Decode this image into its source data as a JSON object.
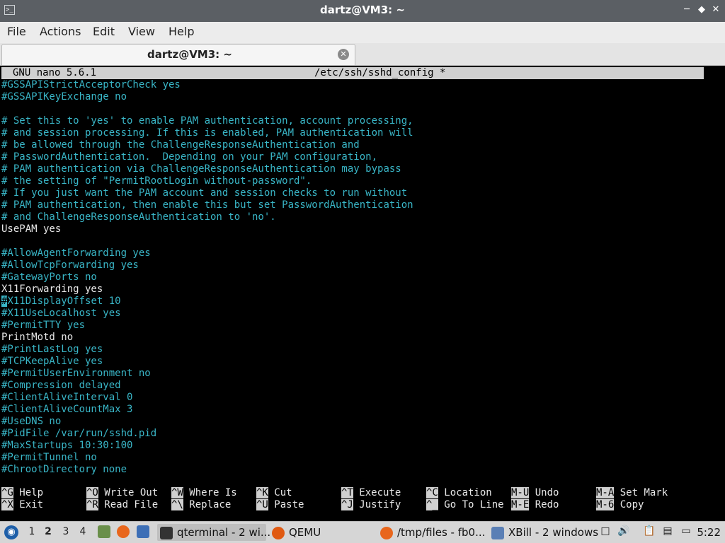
{
  "window": {
    "title": "dartz@VM3: ~",
    "app_icon_text": ">_",
    "min_glyph": "─",
    "max_glyph": "◆",
    "close_glyph": "✕"
  },
  "menu": [
    "File",
    "Actions",
    "Edit",
    "View",
    "Help"
  ],
  "tab": {
    "label": "dartz@VM3: ~",
    "close_glyph": "✕"
  },
  "nano": {
    "version": "GNU nano 5.6.1",
    "file": "/etc/ssh/sshd_config *"
  },
  "lines": [
    {
      "t": "#GSSAPIStrictAcceptorCheck yes",
      "s": "c"
    },
    {
      "t": "#GSSAPIKeyExchange no",
      "s": "c"
    },
    {
      "t": "",
      "s": "c"
    },
    {
      "t": "# Set this to 'yes' to enable PAM authentication, account processing,",
      "s": "c"
    },
    {
      "t": "# and session processing. If this is enabled, PAM authentication will",
      "s": "c"
    },
    {
      "t": "# be allowed through the ChallengeResponseAuthentication and",
      "s": "c"
    },
    {
      "t": "# PasswordAuthentication.  Depending on your PAM configuration,",
      "s": "c"
    },
    {
      "t": "# PAM authentication via ChallengeResponseAuthentication may bypass",
      "s": "c"
    },
    {
      "t": "# the setting of \"PermitRootLogin without-password\".",
      "s": "c"
    },
    {
      "t": "# If you just want the PAM account and session checks to run without",
      "s": "c"
    },
    {
      "t": "# PAM authentication, then enable this but set PasswordAuthentication",
      "s": "c"
    },
    {
      "t": "# and ChallengeResponseAuthentication to 'no'.",
      "s": "c"
    },
    {
      "t": "UsePAM yes",
      "s": "w"
    },
    {
      "t": "",
      "s": "c"
    },
    {
      "t": "#AllowAgentForwarding yes",
      "s": "c"
    },
    {
      "t": "#AllowTcpForwarding yes",
      "s": "c"
    },
    {
      "t": "#GatewayPorts no",
      "s": "c"
    },
    {
      "t": "X11Forwarding yes",
      "s": "w"
    },
    {
      "t": "#X11DisplayOffset 10",
      "s": "c",
      "cursor": true
    },
    {
      "t": "#X11UseLocalhost yes",
      "s": "c"
    },
    {
      "t": "#PermitTTY yes",
      "s": "c"
    },
    {
      "t": "PrintMotd no",
      "s": "w"
    },
    {
      "t": "#PrintLastLog yes",
      "s": "c"
    },
    {
      "t": "#TCPKeepAlive yes",
      "s": "c"
    },
    {
      "t": "#PermitUserEnvironment no",
      "s": "c"
    },
    {
      "t": "#Compression delayed",
      "s": "c"
    },
    {
      "t": "#ClientAliveInterval 0",
      "s": "c"
    },
    {
      "t": "#ClientAliveCountMax 3",
      "s": "c"
    },
    {
      "t": "#UseDNS no",
      "s": "c"
    },
    {
      "t": "#PidFile /var/run/sshd.pid",
      "s": "c"
    },
    {
      "t": "#MaxStartups 10:30:100",
      "s": "c"
    },
    {
      "t": "#PermitTunnel no",
      "s": "c"
    },
    {
      "t": "#ChrootDirectory none",
      "s": "c"
    }
  ],
  "shortcuts": [
    [
      {
        "k": "^G",
        "l": "Help"
      },
      {
        "k": "^X",
        "l": "Exit"
      }
    ],
    [
      {
        "k": "^O",
        "l": "Write Out"
      },
      {
        "k": "^R",
        "l": "Read File"
      }
    ],
    [
      {
        "k": "^W",
        "l": "Where Is"
      },
      {
        "k": "^\\",
        "l": "Replace"
      }
    ],
    [
      {
        "k": "^K",
        "l": "Cut"
      },
      {
        "k": "^U",
        "l": "Paste"
      }
    ],
    [
      {
        "k": "^T",
        "l": "Execute"
      },
      {
        "k": "^J",
        "l": "Justify"
      }
    ],
    [
      {
        "k": "^C",
        "l": "Location"
      },
      {
        "k": "^_",
        "l": "Go To Line"
      }
    ],
    [
      {
        "k": "M-U",
        "l": "Undo"
      },
      {
        "k": "M-E",
        "l": "Redo"
      }
    ],
    [
      {
        "k": "M-A",
        "l": "Set Mark"
      },
      {
        "k": "M-6",
        "l": "Copy"
      }
    ]
  ],
  "panel": {
    "desktops": [
      "1",
      "2",
      "3",
      "4"
    ],
    "active_desktop": "2",
    "tasks": [
      {
        "label": "qterminal - 2 wi...",
        "icon": "terminal-icon",
        "color": "#333333",
        "active": true
      },
      {
        "label": "QEMU",
        "icon": "qemu-icon",
        "color": "#e05a12",
        "active": false
      },
      {
        "label": "/tmp/files - fb0...",
        "icon": "firefox-icon",
        "color": "#e8661c",
        "active": false
      },
      {
        "label": "XBill - 2 windows",
        "icon": "xbill-icon",
        "color": "#5a7fb5",
        "active": false
      }
    ],
    "clock": "5:22"
  },
  "colors": {
    "comment": "#39b5c6",
    "text": "#e8e8e8",
    "titlebar": "#5b5f64",
    "menu_button": "#1e5fa8"
  }
}
